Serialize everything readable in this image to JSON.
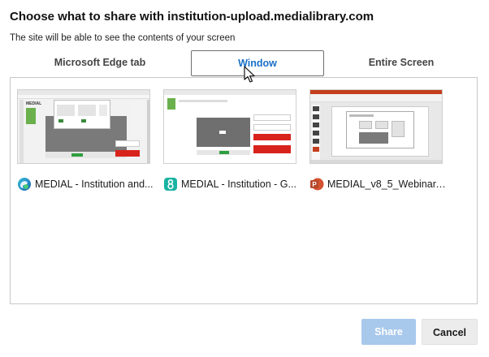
{
  "dialog": {
    "title": "Choose what to share with institution-upload.medialibrary.com",
    "subtitle": "The site will be able to see the contents of your screen"
  },
  "tabs": [
    {
      "label": "Microsoft Edge tab",
      "selected": false
    },
    {
      "label": "Window",
      "selected": true
    },
    {
      "label": "Entire Screen",
      "selected": false
    }
  ],
  "windows": [
    {
      "label": "MEDIAL - Institution and...",
      "icon": "edge-icon",
      "thumb_caption": "MEDIAL"
    },
    {
      "label": "MEDIAL - Institution - G...",
      "icon": "medial-app-icon",
      "thumb_caption": ""
    },
    {
      "label": "MEDIAL_v8_5_Webinar.p...",
      "icon": "powerpoint-icon",
      "thumb_caption": ""
    }
  ],
  "buttons": {
    "share": "Share",
    "cancel": "Cancel"
  },
  "colors": {
    "accent": "#1a6fc6",
    "share_disabled": "#a8c8ec",
    "cancel_bg": "#ececec"
  }
}
